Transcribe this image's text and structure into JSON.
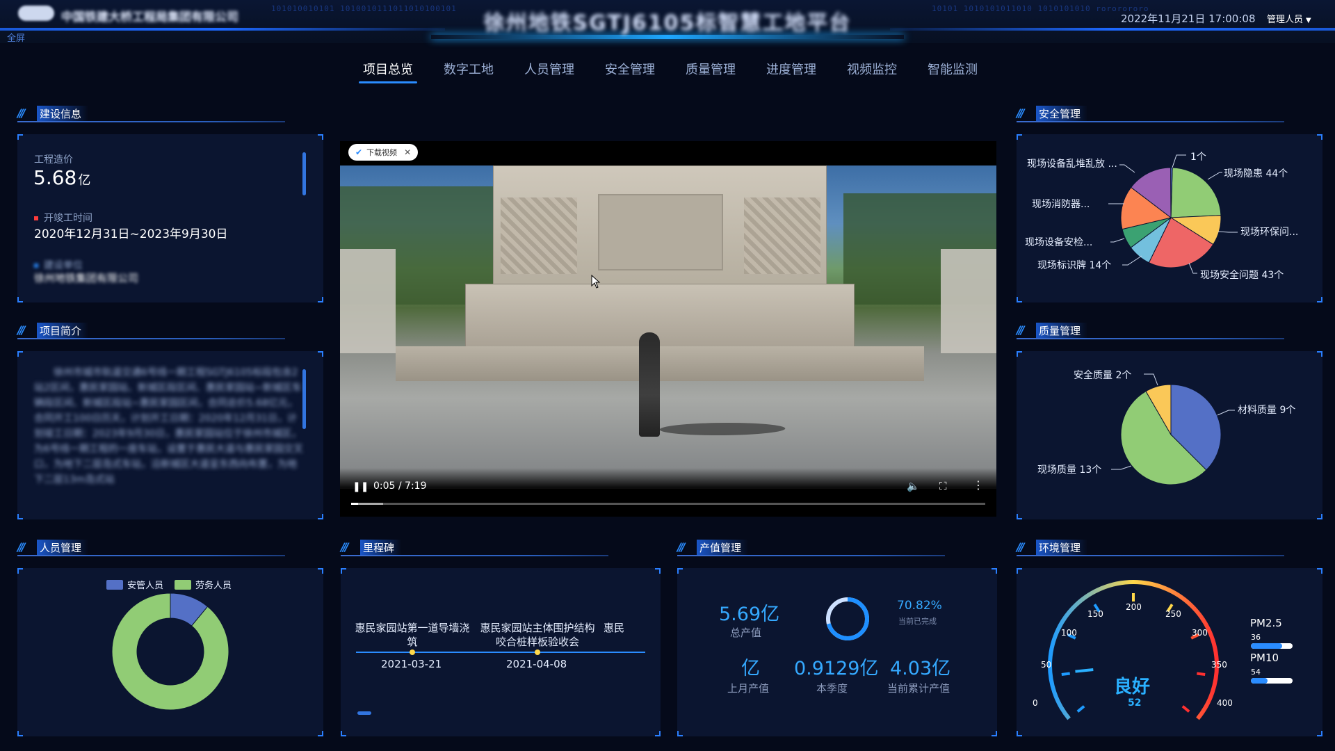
{
  "header": {
    "company": "中国铁建大桥工程局集团有限公司",
    "title": "徐州地铁SGTJ6105标智慧工地平台",
    "fullscreen": "全屏",
    "datetime": "2022年11月21日 17:00:08",
    "user": "管理人员",
    "binary_left": "101010010101 1010010111011010100101",
    "binary_right": "10101 1010101011010 1010101010 rororororo"
  },
  "nav": {
    "tabs": [
      {
        "label": "项目总览",
        "active": true
      },
      {
        "label": "数字工地"
      },
      {
        "label": "人员管理"
      },
      {
        "label": "安全管理"
      },
      {
        "label": "质量管理"
      },
      {
        "label": "进度管理"
      },
      {
        "label": "视频监控"
      },
      {
        "label": "智能监测"
      }
    ]
  },
  "sections": {
    "build_info": "建设信息",
    "intro": "项目简介",
    "personnel": "人员管理",
    "milestone": "里程碑",
    "output_value": "产值管理",
    "safety": "安全管理",
    "quality": "质量管理",
    "environment": "环境管理"
  },
  "build_info": {
    "cost_label": "工程造价",
    "cost_value": "5.68",
    "cost_unit": "亿",
    "period_label": "开竣工时间",
    "period_value": "2020年12月31日~2023年9月30日",
    "builder_label": "建设单位",
    "builder_value": "徐州地铁集团有限公司"
  },
  "intro": {
    "text": "徐州市城市轨道交通6号线一期工程SGTJ6105标段包含2站2区间，惠民家园站、新城区段区间、惠民家园站~新城区车辆段区间、新城区段站~惠民家园区间，合同总价5.68亿元，合同开工100日历天，计划开工日期：2020年12月31日，计划竣工日期：2023年9月30日，惠民家园站位于徐州市城区，为6号线一期工程的一座车站，设置于惠民大道与惠民家园交叉口，为地下二层岛式车站，沿新城区大道呈东西向布置，为地下二层13m岛式站"
  },
  "video": {
    "download_label": "下载视频",
    "time": "0:05 / 7:19",
    "progress": 0.0114,
    "buffered": 0.05
  },
  "personnel": {
    "legend": [
      {
        "name": "安管人员",
        "color": "#5470c6"
      },
      {
        "name": "劳务人员",
        "color": "#91cc75"
      }
    ],
    "values": [
      11,
      89
    ]
  },
  "milestone": {
    "items": [
      {
        "title": "惠民家园站第一道导墙浇筑",
        "date": "2021-03-21"
      },
      {
        "title": "惠民家园站主体围护结构咬合桩样板验收会",
        "date": "2021-04-08"
      },
      {
        "title": "惠民",
        "date": ""
      }
    ]
  },
  "output_value": {
    "total": "5.69亿",
    "total_label": "总产值",
    "pct": "70.82%",
    "pct_label": "当前已完成",
    "completion": 0.7082,
    "last_month": "亿",
    "last_month_label": "上月产值",
    "quarter": "0.9129亿",
    "quarter_label": "本季度",
    "cumulative": "4.03亿",
    "cumulative_label": "当前累计产值"
  },
  "chart_data": [
    {
      "type": "pie",
      "title": "安全管理",
      "categories": [
        "现场隐患",
        "现场环保问...",
        "现场安全问题",
        "现场标识牌",
        "现场设备安检...",
        "现场消防器...",
        "现场设备乱堆乱放 ...",
        ""
      ],
      "labels": [
        "现场隐患 44个",
        "现场环保问...",
        "现场安全问题 43个",
        "现场标识牌 14个",
        "现场设备安检...",
        "现场消防器...",
        "现场设备乱堆乱放 ...",
        "1个"
      ],
      "values": [
        44,
        18,
        43,
        14,
        12,
        26,
        27,
        1
      ],
      "colors": [
        "#91cc75",
        "#fac858",
        "#ee6666",
        "#73c0de",
        "#3ba272",
        "#fc8452",
        "#9a60b4",
        "#5470c6"
      ]
    },
    {
      "type": "pie",
      "title": "质量管理",
      "categories": [
        "材料质量",
        "现场质量",
        "安全质量"
      ],
      "labels": [
        "材料质量 9个",
        "现场质量 13个",
        "安全质量 2个"
      ],
      "values": [
        9,
        13,
        2
      ],
      "colors": [
        "#5470c6",
        "#91cc75",
        "#fac858"
      ]
    },
    {
      "type": "pie",
      "title": "人员管理",
      "categories": [
        "安管人员",
        "劳务人员"
      ],
      "values": [
        11,
        89
      ],
      "colors": [
        "#5470c6",
        "#91cc75"
      ]
    }
  ],
  "environment": {
    "status": "良好",
    "aqi": 52,
    "gauge_max": 400,
    "ticks": [
      "0",
      "50",
      "100",
      "150",
      "200",
      "250",
      "300",
      "350",
      "400"
    ],
    "pm25_label": "PM2.5",
    "pm25_value": "36",
    "pm25_level": 0.75,
    "pm10_label": "PM10",
    "pm10_value": "54",
    "pm10_level": 0.4
  }
}
